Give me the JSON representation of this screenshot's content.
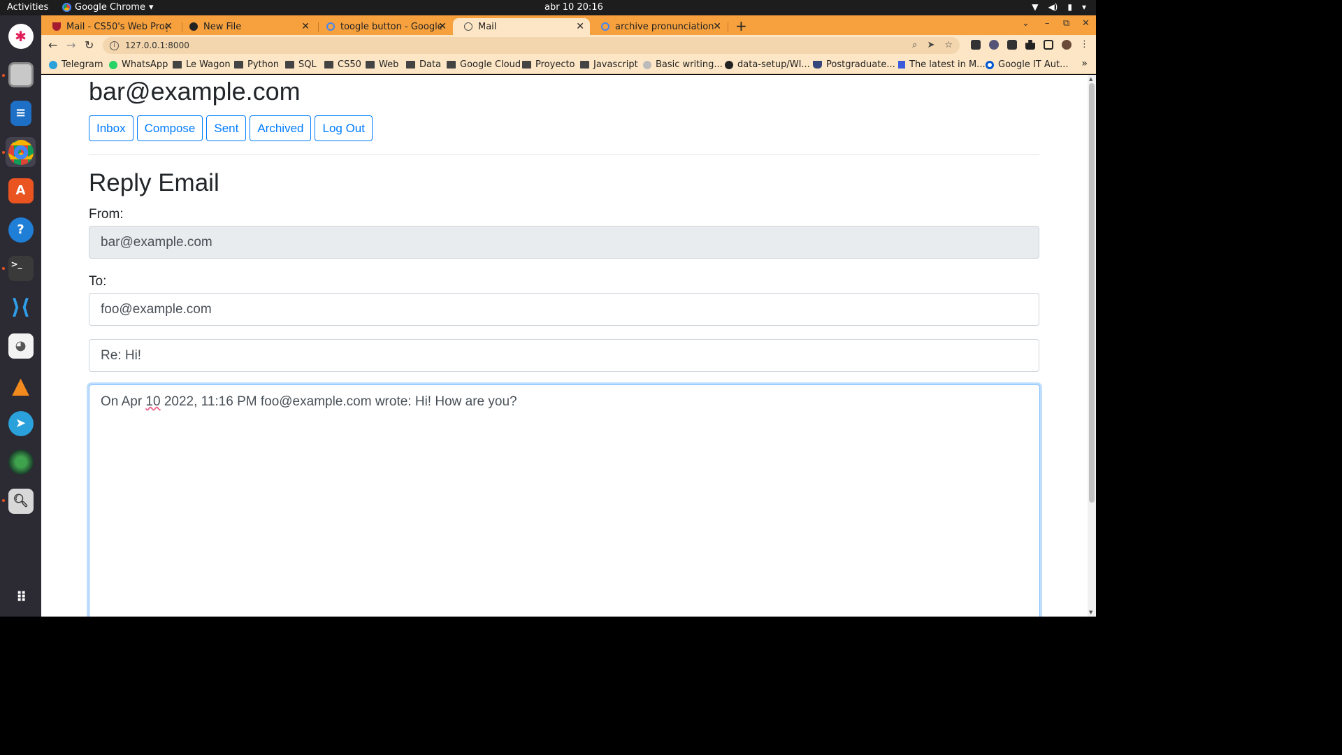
{
  "system": {
    "activities": "Activities",
    "app_name": "Google Chrome",
    "clock": "abr 10  20:16"
  },
  "tabs": [
    {
      "label": "Mail - CS50's Web Progran",
      "favicon": "harvard-shield-icon"
    },
    {
      "label": "New File",
      "favicon": "github-icon"
    },
    {
      "label": "toogle button - Google Se",
      "favicon": "google-icon"
    },
    {
      "label": "Mail",
      "favicon": "globe-icon",
      "active": true
    },
    {
      "label": "archive pronunciation - Go",
      "favicon": "google-icon"
    }
  ],
  "address_bar": {
    "url": "127.0.0.1:8000"
  },
  "bookmarks": [
    {
      "label": "Telegram",
      "icon": "telegram-icon"
    },
    {
      "label": "WhatsApp",
      "icon": "whatsapp-icon"
    },
    {
      "label": "Le Wagon",
      "icon": "folder-icon"
    },
    {
      "label": "Python",
      "icon": "folder-icon"
    },
    {
      "label": "SQL",
      "icon": "folder-icon"
    },
    {
      "label": "CS50",
      "icon": "folder-icon"
    },
    {
      "label": "Web",
      "icon": "folder-icon"
    },
    {
      "label": "Data",
      "icon": "folder-icon"
    },
    {
      "label": "Google Cloud",
      "icon": "folder-icon"
    },
    {
      "label": "Proyecto",
      "icon": "folder-icon"
    },
    {
      "label": "Javascript",
      "icon": "folder-icon"
    },
    {
      "label": "Basic writing...",
      "icon": "github-icon"
    },
    {
      "label": "data-setup/WI...",
      "icon": "github-icon"
    },
    {
      "label": "Postgraduate...",
      "icon": "shield-icon"
    },
    {
      "label": "The latest in M...",
      "icon": "bookmark-icon"
    },
    {
      "label": "Google IT Aut...",
      "icon": "coursera-icon"
    }
  ],
  "page": {
    "user_email": "bar@example.com",
    "nav": {
      "inbox": "Inbox",
      "compose": "Compose",
      "sent": "Sent",
      "archived": "Archived",
      "logout": "Log Out"
    },
    "heading": "Reply Email",
    "from_label": "From:",
    "from_value": "bar@example.com",
    "to_label": "To:",
    "to_value": "foo@example.com",
    "subject_value": "Re: Hi!",
    "body_before": "On Apr ",
    "body_flagged": "10",
    "body_after": " 2022, 11:16 PM foo@example.com wrote: Hi! How are you?"
  },
  "colors": {
    "tab_strip": "#f6a13e",
    "toolbar": "#fde6c5",
    "primary": "#007bff"
  }
}
